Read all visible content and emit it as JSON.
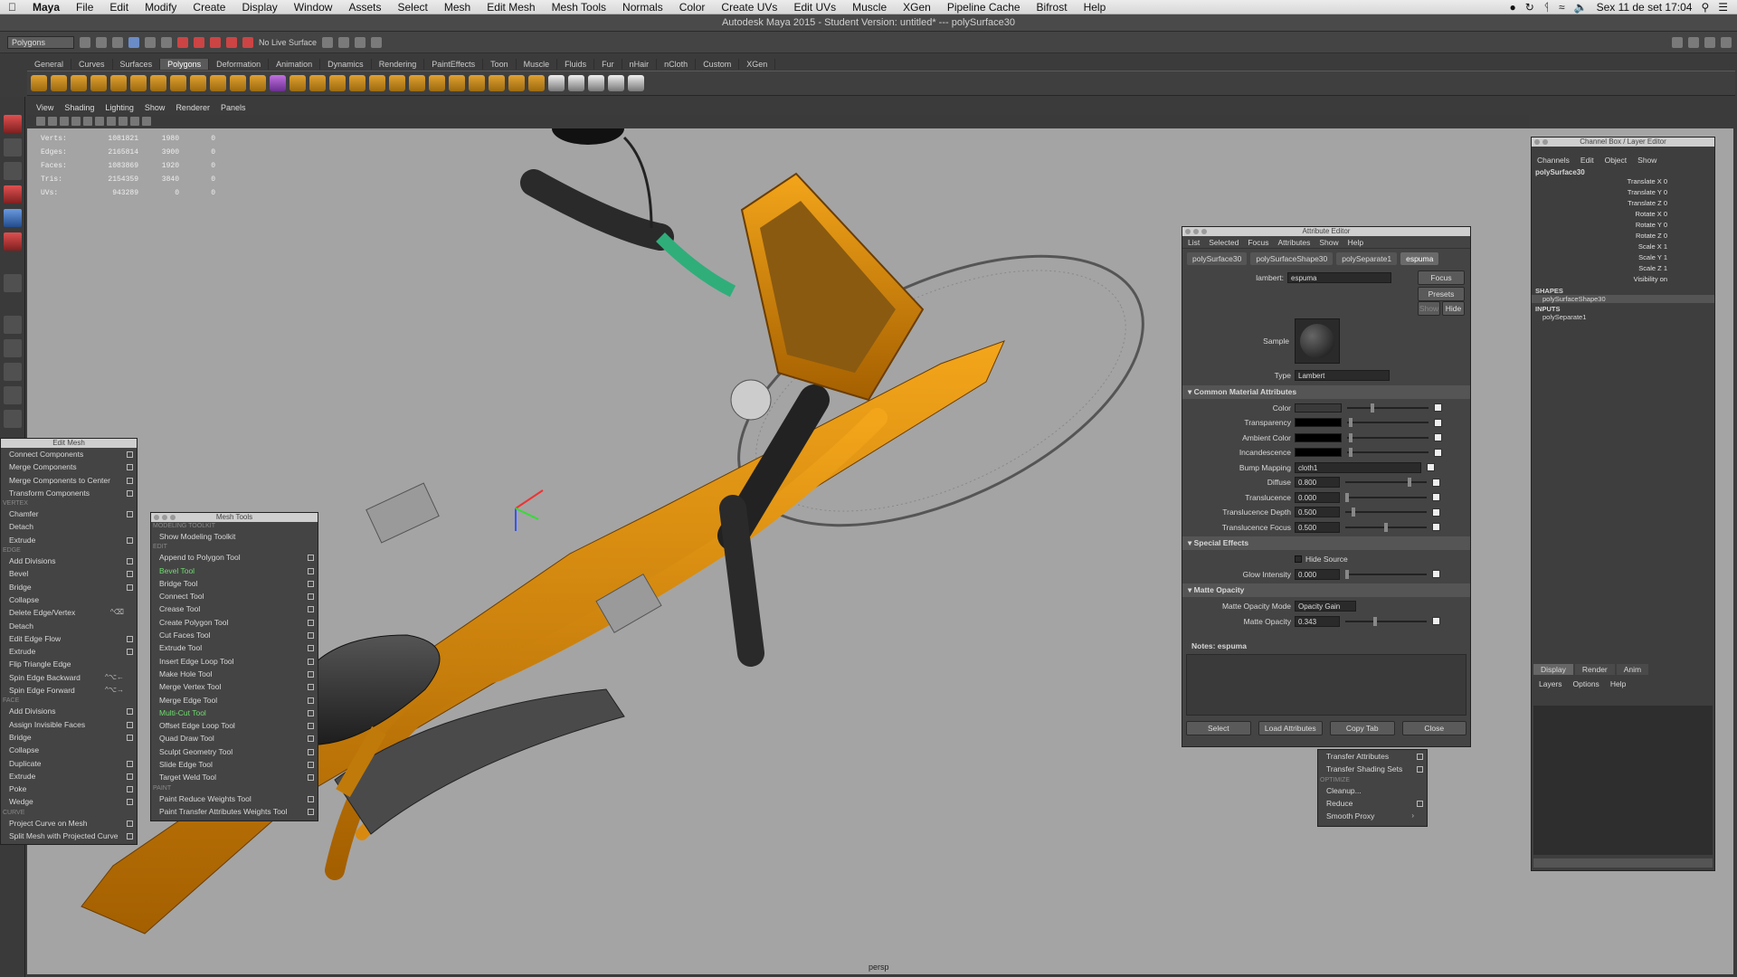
{
  "macbar": {
    "app": "Maya",
    "menus": [
      "File",
      "Edit",
      "Modify",
      "Create",
      "Display",
      "Window",
      "Assets",
      "Select",
      "Mesh",
      "Edit Mesh",
      "Mesh Tools",
      "Normals",
      "Color",
      "Create UVs",
      "Edit UVs",
      "Muscle",
      "XGen",
      "Pipeline Cache",
      "Bifrost",
      "Help"
    ],
    "datetime": "Sex 11 de set  17:04"
  },
  "window_title": "Autodesk Maya 2015 - Student Version: untitled*   ---   polySurface30",
  "status_line": {
    "menu_set": "Polygons",
    "live_surface": "No Live Surface"
  },
  "shelf_tabs": [
    "General",
    "Curves",
    "Surfaces",
    "Polygons",
    "Deformation",
    "Animation",
    "Dynamics",
    "Rendering",
    "PaintEffects",
    "Toon",
    "Muscle",
    "Fluids",
    "Fur",
    "nHair",
    "nCloth",
    "Custom",
    "XGen"
  ],
  "active_shelf_tab": "Polygons",
  "panel_menu": [
    "View",
    "Shading",
    "Lighting",
    "Show",
    "Renderer",
    "Panels"
  ],
  "hud": [
    [
      "Verts:",
      "1081821",
      "1980",
      "0"
    ],
    [
      "Edges:",
      "2165814",
      "3900",
      "0"
    ],
    [
      "Faces:",
      "1083869",
      "1920",
      "0"
    ],
    [
      "Tris:",
      "2154359",
      "3840",
      "0"
    ],
    [
      "UVs:",
      "943289",
      "0",
      "0"
    ]
  ],
  "camera_label": "persp",
  "edit_mesh_window": {
    "title": "Edit Mesh",
    "rows": [
      {
        "t": "item",
        "label": "Connect Components",
        "box": true
      },
      {
        "t": "item",
        "label": "Merge Components",
        "box": true
      },
      {
        "t": "item",
        "label": "Merge Components to Center",
        "box": true
      },
      {
        "t": "item",
        "label": "Transform Components",
        "box": true
      },
      {
        "t": "sec",
        "label": "VERTEX"
      },
      {
        "t": "item",
        "label": "Chamfer",
        "box": true
      },
      {
        "t": "item",
        "label": "Detach",
        "box": false
      },
      {
        "t": "item",
        "label": "Extrude",
        "box": true
      },
      {
        "t": "sec",
        "label": "EDGE"
      },
      {
        "t": "item",
        "label": "Add Divisions",
        "box": true
      },
      {
        "t": "item",
        "label": "Bevel",
        "box": true
      },
      {
        "t": "item",
        "label": "Bridge",
        "box": true
      },
      {
        "t": "item",
        "label": "Collapse",
        "box": false
      },
      {
        "t": "item",
        "label": "Delete Edge/Vertex",
        "box": false,
        "sc": "^⌫"
      },
      {
        "t": "item",
        "label": "Detach",
        "box": false
      },
      {
        "t": "item",
        "label": "Edit Edge Flow",
        "box": true
      },
      {
        "t": "item",
        "label": "Extrude",
        "box": true
      },
      {
        "t": "item",
        "label": "Flip Triangle Edge",
        "box": false
      },
      {
        "t": "item",
        "label": "Spin Edge Backward",
        "box": false,
        "sc": "^⌥←"
      },
      {
        "t": "item",
        "label": "Spin Edge Forward",
        "box": false,
        "sc": "^⌥→"
      },
      {
        "t": "sec",
        "label": "FACE"
      },
      {
        "t": "item",
        "label": "Add Divisions",
        "box": true
      },
      {
        "t": "item",
        "label": "Assign Invisible Faces",
        "box": true
      },
      {
        "t": "item",
        "label": "Bridge",
        "box": true
      },
      {
        "t": "item",
        "label": "Collapse",
        "box": false
      },
      {
        "t": "item",
        "label": "Duplicate",
        "box": true
      },
      {
        "t": "item",
        "label": "Extrude",
        "box": true
      },
      {
        "t": "item",
        "label": "Poke",
        "box": true
      },
      {
        "t": "item",
        "label": "Wedge",
        "box": true
      },
      {
        "t": "sec",
        "label": "CURVE"
      },
      {
        "t": "item",
        "label": "Project Curve on Mesh",
        "box": true
      },
      {
        "t": "item",
        "label": "Split Mesh with Projected Curve",
        "box": true
      }
    ]
  },
  "mesh_tools_window": {
    "title": "Mesh Tools",
    "rows": [
      {
        "t": "sec",
        "label": "MODELING TOOLKIT"
      },
      {
        "t": "item",
        "label": "Show Modeling Toolkit",
        "box": false
      },
      {
        "t": "sec",
        "label": "EDIT"
      },
      {
        "t": "item",
        "label": "Append to Polygon Tool",
        "box": true
      },
      {
        "t": "item",
        "label": "Bevel Tool",
        "box": true,
        "hl": true
      },
      {
        "t": "item",
        "label": "Bridge Tool",
        "box": true
      },
      {
        "t": "item",
        "label": "Connect Tool",
        "box": true
      },
      {
        "t": "item",
        "label": "Crease Tool",
        "box": true
      },
      {
        "t": "item",
        "label": "Create Polygon Tool",
        "box": true
      },
      {
        "t": "item",
        "label": "Cut Faces Tool",
        "box": true
      },
      {
        "t": "item",
        "label": "Extrude Tool",
        "box": true
      },
      {
        "t": "item",
        "label": "Insert Edge Loop Tool",
        "box": true
      },
      {
        "t": "item",
        "label": "Make Hole Tool",
        "box": true
      },
      {
        "t": "item",
        "label": "Merge Vertex Tool",
        "box": true
      },
      {
        "t": "item",
        "label": "Merge Edge Tool",
        "box": true
      },
      {
        "t": "item",
        "label": "Multi-Cut Tool",
        "box": true,
        "hl": true
      },
      {
        "t": "item",
        "label": "Offset Edge Loop Tool",
        "box": true
      },
      {
        "t": "item",
        "label": "Quad Draw Tool",
        "box": true
      },
      {
        "t": "item",
        "label": "Sculpt Geometry Tool",
        "box": true
      },
      {
        "t": "item",
        "label": "Slide Edge Tool",
        "box": true
      },
      {
        "t": "item",
        "label": "Target Weld Tool",
        "box": true
      },
      {
        "t": "sec",
        "label": "PAINT"
      },
      {
        "t": "item",
        "label": "Paint Reduce Weights Tool",
        "box": true
      },
      {
        "t": "item",
        "label": "Paint Transfer Attributes Weights Tool",
        "box": true
      }
    ]
  },
  "mesh_popup": {
    "rows": [
      {
        "t": "item",
        "label": "Transfer Attributes",
        "box": true
      },
      {
        "t": "item",
        "label": "Transfer Shading Sets",
        "box": true
      },
      {
        "t": "sec",
        "label": "OPTIMIZE"
      },
      {
        "t": "item",
        "label": "Cleanup...",
        "box": false
      },
      {
        "t": "item",
        "label": "Reduce",
        "box": true
      },
      {
        "t": "item",
        "label": "Smooth Proxy",
        "box": false,
        "sc": "›"
      }
    ]
  },
  "attribute_editor": {
    "title": "Attribute Editor",
    "menu": [
      "List",
      "Selected",
      "Focus",
      "Attributes",
      "Show",
      "Help"
    ],
    "tabs": [
      "polySurface30",
      "polySurfaceShape30",
      "polySeparate1",
      "espuma"
    ],
    "active_tab": "espuma",
    "node_type_label": "lambert:",
    "node_name": "espuma",
    "focus_btn": "Focus",
    "presets_btn": "Presets",
    "show_btn": "Show",
    "hide_btn": "Hide",
    "sample_label": "Sample",
    "type_label": "Type",
    "type_value": "Lambert",
    "sections": {
      "common": "Common Material Attributes",
      "special": "Special Effects",
      "matte": "Matte Opacity"
    },
    "common_rows": [
      {
        "label": "Color",
        "kind": "swatch",
        "value": "",
        "color": "#3a3a3a",
        "slider": 0.3
      },
      {
        "label": "Transparency",
        "kind": "swatch",
        "value": "",
        "color": "#000000",
        "slider": 0.02
      },
      {
        "label": "Ambient Color",
        "kind": "swatch",
        "value": "",
        "color": "#000000",
        "slider": 0.02
      },
      {
        "label": "Incandescence",
        "kind": "swatch",
        "value": "",
        "color": "#000000",
        "slider": 0.02
      },
      {
        "label": "Bump Mapping",
        "kind": "text",
        "value": "cloth1",
        "slider": null
      },
      {
        "label": "Diffuse",
        "kind": "num",
        "value": "0.800",
        "slider": 0.8
      },
      {
        "label": "Translucence",
        "kind": "num",
        "value": "0.000",
        "slider": 0.0
      },
      {
        "label": "Translucence Depth",
        "kind": "num",
        "value": "0.500",
        "slider": 0.08
      },
      {
        "label": "Translucence Focus",
        "kind": "num",
        "value": "0.500",
        "slider": 0.5
      }
    ],
    "hide_source_label": "Hide Source",
    "glow_label": "Glow Intensity",
    "glow_value": "0.000",
    "matte_mode_label": "Matte Opacity Mode",
    "matte_mode_value": "Opacity Gain",
    "matte_label": "Matte Opacity",
    "matte_value": "0.343",
    "notes_label": "Notes:  espuma",
    "buttons": [
      "Select",
      "Load Attributes",
      "Copy Tab",
      "Close"
    ]
  },
  "channel_box": {
    "title": "Channel Box / Layer Editor",
    "menu": [
      "Channels",
      "Edit",
      "Object",
      "Show"
    ],
    "object": "polySurface30",
    "channels": [
      [
        "Translate X",
        "0"
      ],
      [
        "Translate Y",
        "0"
      ],
      [
        "Translate Z",
        "0"
      ],
      [
        "Rotate X",
        "0"
      ],
      [
        "Rotate Y",
        "0"
      ],
      [
        "Rotate Z",
        "0"
      ],
      [
        "Scale X",
        "1"
      ],
      [
        "Scale Y",
        "1"
      ],
      [
        "Scale Z",
        "1"
      ],
      [
        "Visibility",
        "on"
      ]
    ],
    "shapes_label": "SHAPES",
    "shape": "polySurfaceShape30",
    "inputs_label": "INPUTS",
    "input": "polySeparate1",
    "layer_tabs": [
      "Display",
      "Render",
      "Anim"
    ],
    "active_layer_tab": "Display",
    "layer_menu": [
      "Layers",
      "Options",
      "Help"
    ]
  },
  "colors": {
    "bike_orange": "#e0920f",
    "viewport": "#a4a4a4",
    "highlight_green": "#6fdc6f"
  }
}
